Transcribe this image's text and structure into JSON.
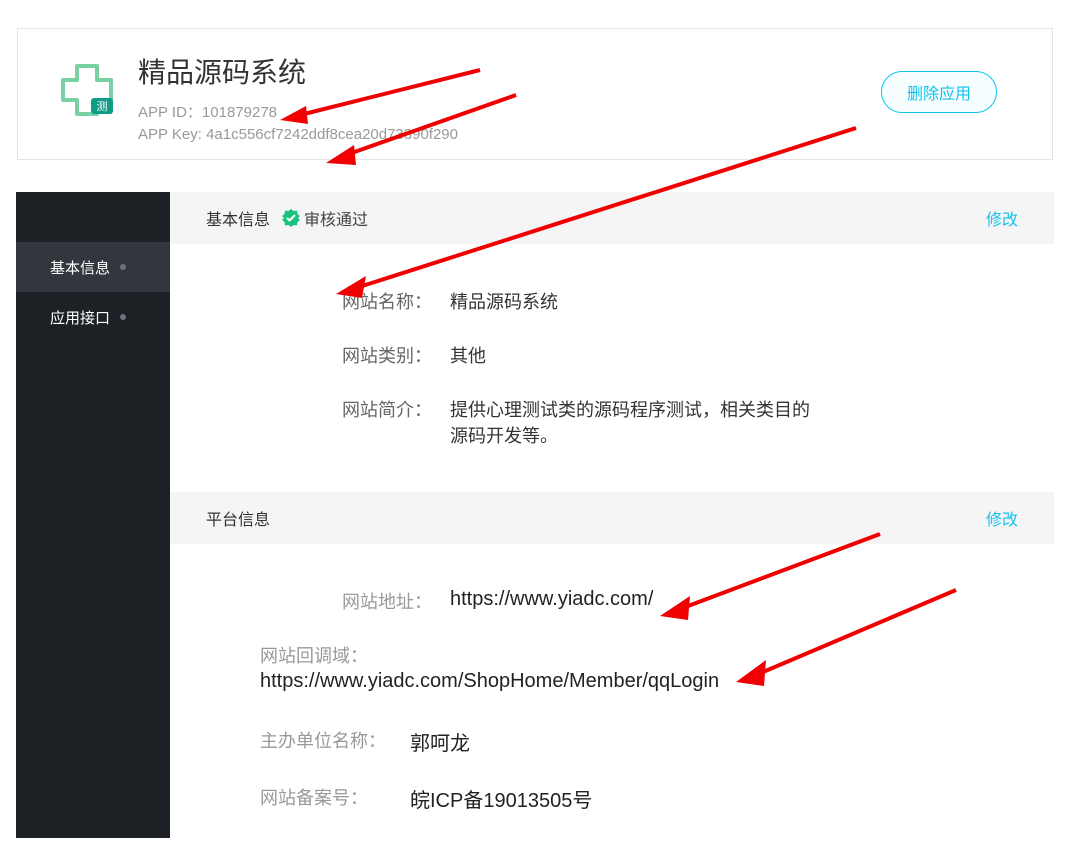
{
  "top": {
    "title": "精品源码系统",
    "app_id_label": "APP ID：",
    "app_id": "101879278",
    "app_key_label": "APP Key:  ",
    "app_key": "4a1c556cf7242ddf8cea20d73390f290",
    "delete_label": "删除应用"
  },
  "sidebar": {
    "items": [
      {
        "label": "基本信息"
      },
      {
        "label": "应用接口"
      }
    ]
  },
  "basic_section": {
    "title": "基本信息",
    "status": "审核通过",
    "modify": "修改",
    "fields": {
      "site_name_label": "网站名称：",
      "site_name": "精品源码系统",
      "site_type_label": "网站类别：",
      "site_type": "其他",
      "site_desc_label": "网站简介：",
      "site_desc": "提供心理测试类的源码程序测试，相关类目的源码开发等。"
    }
  },
  "platform_section": {
    "title": "平台信息",
    "modify": "修改",
    "fields": {
      "site_url_label": "网站地址：",
      "site_url": "https://www.yiadc.com/",
      "callback_label": "网站回调域：",
      "callback": "https://www.yiadc.com/ShopHome/Member/qqLogin",
      "org_label": "主办单位名称：",
      "org": "郭呵龙",
      "icp_label": "网站备案号：",
      "icp": "皖ICP备19013505号"
    }
  }
}
